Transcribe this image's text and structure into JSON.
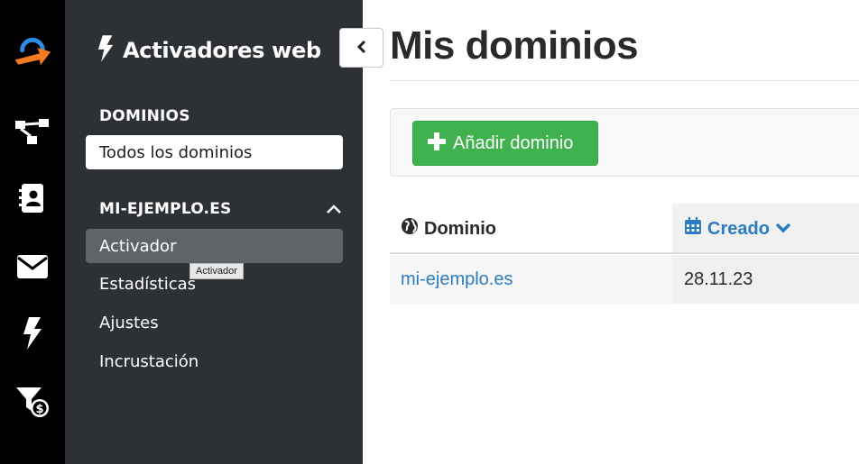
{
  "rail": {
    "items": [
      {
        "icon": "logo-icon"
      },
      {
        "icon": "workflow-icon"
      },
      {
        "icon": "contacts-icon"
      },
      {
        "icon": "email-icon"
      },
      {
        "icon": "lightning-icon"
      },
      {
        "icon": "funnel-dollar-icon"
      }
    ],
    "accent_color": "#f47b20",
    "brand_blue": "#2c8fe5"
  },
  "sidebar": {
    "title": "Activadores web",
    "title_icon": "lightning-icon",
    "collapse_icon": "chevron-left-icon",
    "sections": [
      {
        "heading": "DOMINIOS",
        "items": [
          {
            "label": "Todos los dominios",
            "state": "selected"
          }
        ]
      },
      {
        "heading": "MI-EJEMPLO.ES",
        "expanded": true,
        "toggle_icon": "chevron-up-icon",
        "items": [
          {
            "label": "Activador",
            "state": "active"
          },
          {
            "label": "Estadísticas"
          },
          {
            "label": "Ajustes"
          },
          {
            "label": "Incrustación"
          }
        ]
      }
    ],
    "tooltip": "Activador"
  },
  "main": {
    "title": "Mis dominios",
    "add_button": {
      "icon": "plus-icon",
      "label": "Añadir dominio",
      "color": "#3fb24f"
    },
    "table": {
      "columns": [
        {
          "label": "Dominio",
          "icon": "globe-icon"
        },
        {
          "label": "Creado",
          "icon": "calendar-icon",
          "sort_icon": "chevron-down-icon",
          "sorted": true
        }
      ],
      "rows": [
        {
          "domain": "mi-ejemplo.es",
          "created": "28.11.23"
        }
      ]
    },
    "link_color": "#2b7cc1"
  }
}
